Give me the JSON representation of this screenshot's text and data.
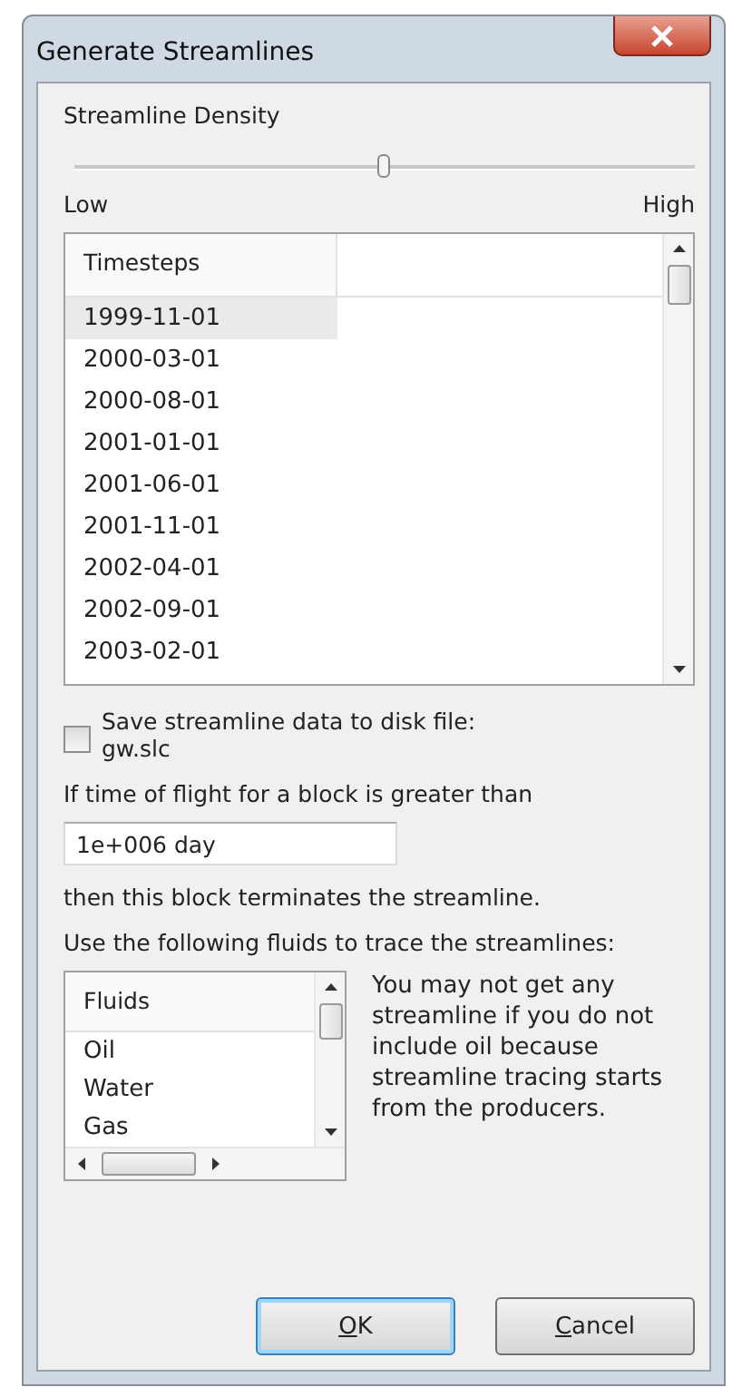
{
  "window": {
    "title": "Generate Streamlines"
  },
  "density": {
    "label": "Streamline Density",
    "level": 0.5,
    "low_label": "Low",
    "high_label": "High"
  },
  "timesteps": {
    "header": "Timesteps",
    "rows": [
      {
        "label": "1999-11-01",
        "selected": true
      },
      {
        "label": "2000-03-01",
        "selected": false
      },
      {
        "label": "2000-08-01",
        "selected": false
      },
      {
        "label": "2001-01-01",
        "selected": false
      },
      {
        "label": "2001-06-01",
        "selected": false
      },
      {
        "label": "2001-11-01",
        "selected": false
      },
      {
        "label": "2002-04-01",
        "selected": false
      },
      {
        "label": "2002-09-01",
        "selected": false
      },
      {
        "label": "2003-02-01",
        "selected": false
      }
    ]
  },
  "save": {
    "label": "Save streamline data to disk file:",
    "file": "gw.slc",
    "checked": false
  },
  "flight_label": "If time of flight for a block is greater than",
  "flight_value": "1e+006 day",
  "terminate_label": "then this block terminates the streamline.",
  "fluids_label": "Use the following fluids to trace the streamlines:",
  "fluids": {
    "header": "Fluids",
    "rows": [
      {
        "label": "Oil"
      },
      {
        "label": "Water"
      },
      {
        "label": "Gas"
      }
    ]
  },
  "note": "You may not get any streamline if you do not include oil because streamline tracing starts from the producers.",
  "buttons": [
    {
      "label": "OK",
      "default": true
    },
    {
      "label": "Cancel",
      "default": false
    }
  ]
}
